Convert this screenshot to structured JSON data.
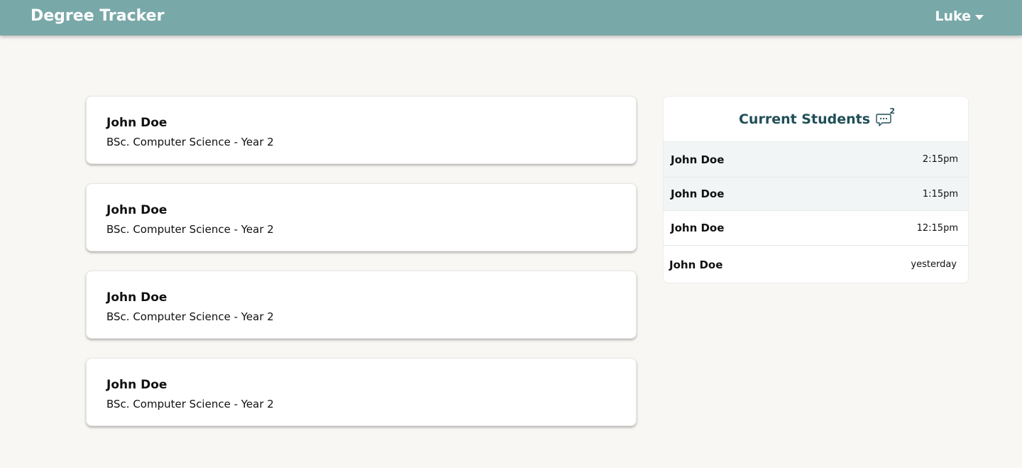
{
  "app": {
    "title": "Degree Tracker",
    "user": "Luke"
  },
  "students": [
    {
      "name": "John Doe",
      "program": "BSc. Computer Science - Year 2"
    },
    {
      "name": "John Doe",
      "program": "BSc. Computer Science - Year 2"
    },
    {
      "name": "John Doe",
      "program": "BSc. Computer Science - Year 2"
    },
    {
      "name": "John Doe",
      "program": "BSc. Computer Science - Year 2"
    }
  ],
  "panel": {
    "title": "Current Students",
    "badge": "2",
    "icon": "chat-icon",
    "rows": [
      {
        "name": "John Doe",
        "time": "2:15pm",
        "unread": true
      },
      {
        "name": "John Doe",
        "time": "1:15pm",
        "unread": true
      },
      {
        "name": "John Doe",
        "time": "12:15pm",
        "unread": false
      },
      {
        "name": "John Doe",
        "time": "yesterday",
        "unread": false
      }
    ]
  },
  "colors": {
    "navbar": "#79a8a8",
    "accent": "#1f4f57",
    "background": "#f8f7f4"
  }
}
